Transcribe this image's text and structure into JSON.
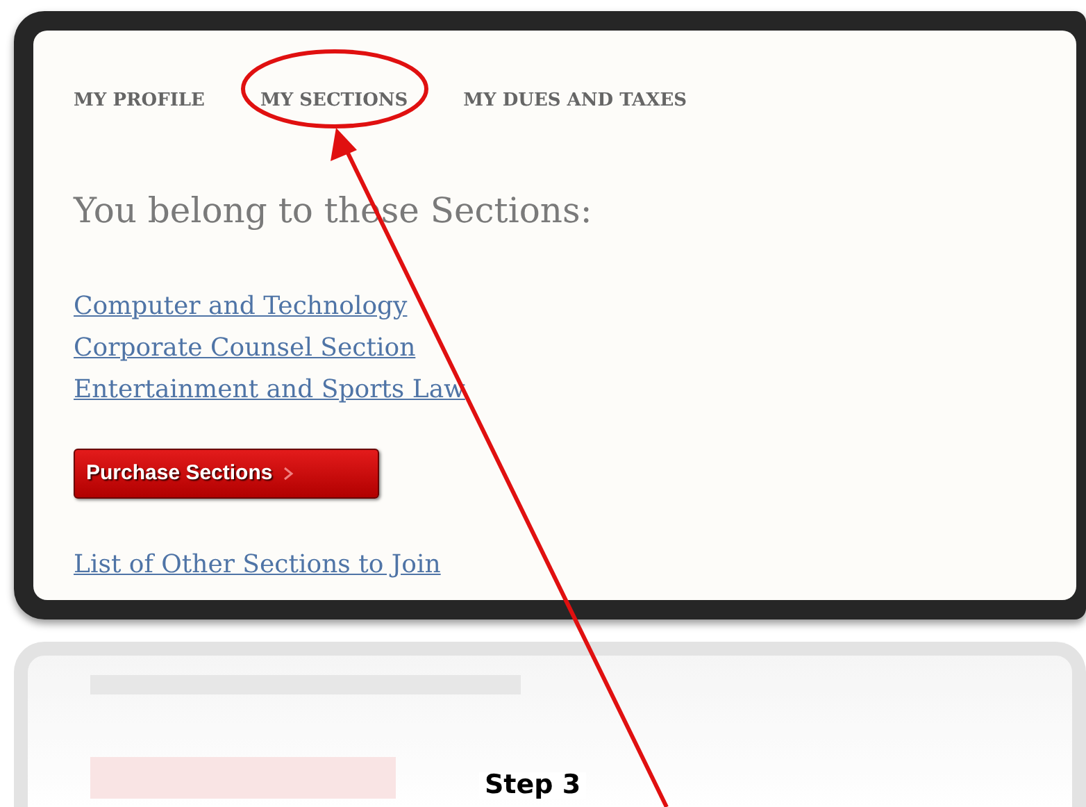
{
  "tabs": [
    {
      "label": "MY PROFILE"
    },
    {
      "label": "MY SECTIONS"
    },
    {
      "label": "MY DUES AND TAXES"
    }
  ],
  "heading": "You belong to these Sections:",
  "sections": [
    "Computer and Technology",
    "Corporate Counsel Section",
    "Entertainment and Sports Law"
  ],
  "purchase_button": "Purchase Sections",
  "other_link": "List of Other Sections to Join",
  "annotation": {
    "label": "Step 3"
  }
}
